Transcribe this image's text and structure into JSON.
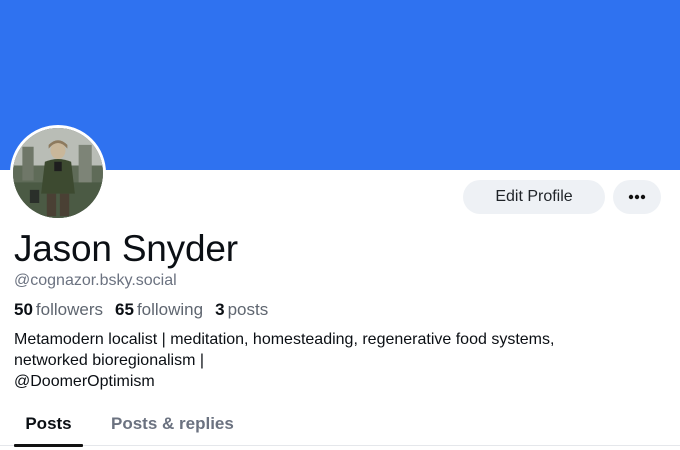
{
  "profile": {
    "display_name": "Jason Snyder",
    "handle": "@cognazor.bsky.social",
    "banner_color": "#2f72f0",
    "avatar_icon": "profile-photo-avatar"
  },
  "actions": {
    "edit_profile_label": "Edit Profile",
    "more_icon": "ellipsis-icon"
  },
  "stats": {
    "followers_count": "50",
    "followers_label": "followers",
    "following_count": "65",
    "following_label": "following",
    "posts_count": "3",
    "posts_label": "posts"
  },
  "bio": {
    "line1": "Metamodern localist | meditation, homesteading, regenerative food systems,",
    "line2": "networked bioregionalism |",
    "line3": "@DoomerOptimism"
  },
  "tabs": [
    {
      "label": "Posts",
      "active": true
    },
    {
      "label": "Posts & replies",
      "active": false
    }
  ]
}
